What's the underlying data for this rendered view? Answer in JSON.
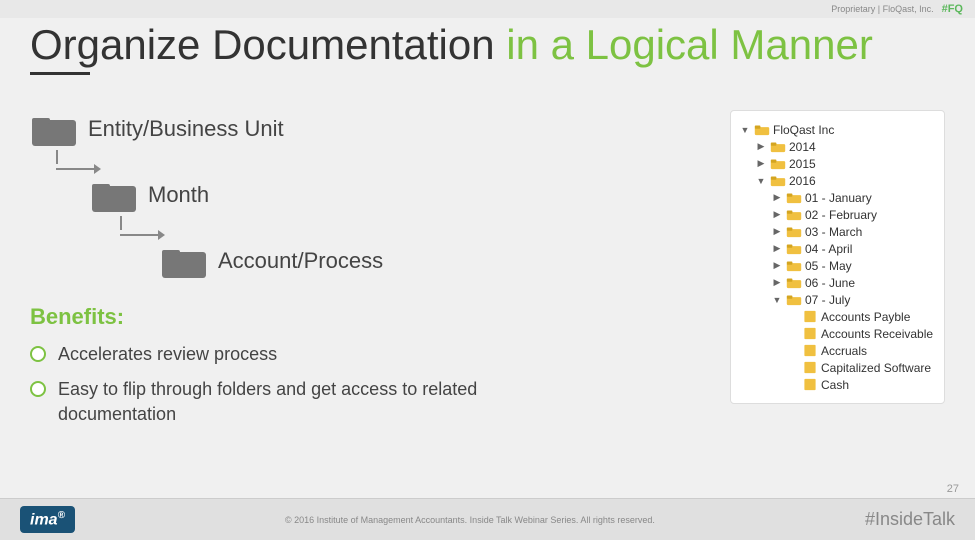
{
  "slide": {
    "proprietary": "Proprietary | FloQast, Inc.",
    "logo_top": "#FQ",
    "title": {
      "part1": "Organize Documentation ",
      "part2": "in a Logical Manner"
    },
    "page_number": "27"
  },
  "diagram": {
    "row1_label": "Entity/Business Unit",
    "row2_label": "Month",
    "row3_label": "Account/Process"
  },
  "benefits": {
    "title": "Benefits:",
    "items": [
      "Accelerates review process",
      "Easy to flip through folders and get access to related documentation"
    ]
  },
  "tree": {
    "root": "FloQast Inc",
    "nodes": [
      {
        "level": 1,
        "toggle": "▶",
        "label": "2014",
        "type": "folder"
      },
      {
        "level": 1,
        "toggle": "▶",
        "label": "2015",
        "type": "folder"
      },
      {
        "level": 1,
        "toggle": "▼",
        "label": "2016",
        "type": "folder"
      },
      {
        "level": 2,
        "toggle": "▶",
        "label": "01 - January",
        "type": "folder"
      },
      {
        "level": 2,
        "toggle": "▶",
        "label": "02 - February",
        "type": "folder"
      },
      {
        "level": 2,
        "toggle": "▶",
        "label": "03 - March",
        "type": "folder"
      },
      {
        "level": 2,
        "toggle": "▶",
        "label": "04 - April",
        "type": "folder"
      },
      {
        "level": 2,
        "toggle": "▶",
        "label": "05 - May",
        "type": "folder"
      },
      {
        "level": 2,
        "toggle": "▶",
        "label": "06 - June",
        "type": "folder"
      },
      {
        "level": 2,
        "toggle": "▼",
        "label": "07 - July",
        "type": "folder"
      },
      {
        "level": 3,
        "toggle": "",
        "label": "Accounts Payble",
        "type": "file"
      },
      {
        "level": 3,
        "toggle": "",
        "label": "Accounts Receivable",
        "type": "file"
      },
      {
        "level": 3,
        "toggle": "",
        "label": "Accruals",
        "type": "file"
      },
      {
        "level": 3,
        "toggle": "",
        "label": "Capitalized Software",
        "type": "file"
      },
      {
        "level": 3,
        "toggle": "",
        "label": "Cash",
        "type": "file"
      }
    ]
  },
  "footer": {
    "ima_label": "ima",
    "trademark": "®",
    "copyright": "© 2016 Institute of Management Accountants. Inside Talk Webinar Series. All rights reserved.",
    "hashtag": "#InsideTalk"
  }
}
